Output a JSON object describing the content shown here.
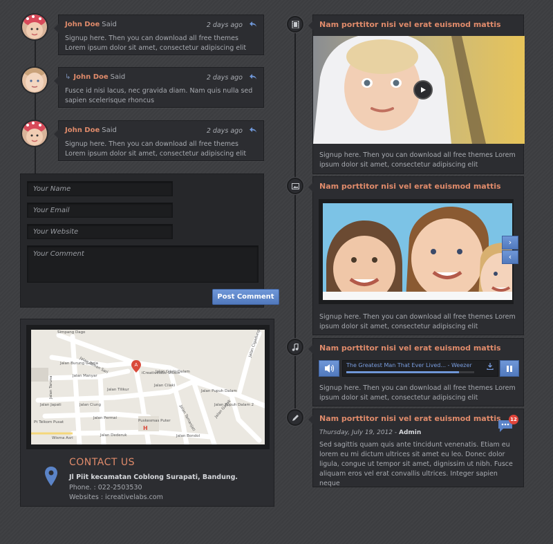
{
  "comments": [
    {
      "author": "John Doe",
      "said": "Said",
      "date": "2 days ago",
      "text": "Signup here. Then you can download all free themes Lorem ipsum dolor sit amet, consectetur adipiscing elit"
    },
    {
      "author": "John Doe",
      "said": "Said",
      "date": "2 days ago",
      "text": "Fusce id nisi lacus, nec gravida diam. Nam quis nulla sed sapien scelerisque rhoncus"
    },
    {
      "author": "John Doe",
      "said": "Said",
      "date": "2 days ago",
      "text": "Signup here. Then you can download all free themes Lorem ipsum dolor sit amet, consectetur adipiscing elit"
    }
  ],
  "form": {
    "name_placeholder": "Your Name",
    "email_placeholder": "Your Email",
    "website_placeholder": "Your Website",
    "comment_placeholder": "Your Comment",
    "submit_label": "Post Comment"
  },
  "map": {
    "labels": {
      "street1": "Jalan Taman Sari",
      "street2": "Jalan Burung Gereja",
      "street3": "Jalan Manyar",
      "street4": "Jalan Taruna",
      "street5": "Jalan Tilikur",
      "street6": "Jalan Japati",
      "street7": "Jalan Ciung",
      "street8": "Jalan Permai",
      "street9": "Jalan Dederuk",
      "street10": "Jalan Cilaki",
      "street11": "Jalan Cilaki Dalam",
      "street12": "Jalan Pupuh Dalam",
      "street13": "Jalan Pupuh Dalam 2",
      "street14": "Jalan Bondol",
      "street15": "Jalan Gagak",
      "street16": "Jalan Tamanjati",
      "street17": "Jalan Cigadung",
      "place1": "Simpang Dago",
      "place2": "iCreativelabs Studio",
      "place3": "Puskesmas Puter",
      "place4": "Pt Telkom Pusat",
      "place5": "Wisma Asri"
    }
  },
  "contact": {
    "title": "CONTACT US",
    "address": "Jl Piit kecamatan Coblong Surapati, Bandung.",
    "phone": "Phone. : 022-2503530",
    "website": "Websites : icreativelabs.com"
  },
  "posts": [
    {
      "title": "Nam porttitor nisi vel erat euismod mattis",
      "text": "Signup here. Then you can download all free themes Lorem ipsum dolor sit amet, consectetur adipiscing elit",
      "icon": "film-icon"
    },
    {
      "title": "Nam porttitor nisi vel erat euismod mattis",
      "text": "Signup here. Then you can download all free themes Lorem ipsum dolor sit amet, consectetur adipiscing elit",
      "icon": "image-icon"
    },
    {
      "title": "Nam porttitor nisi vel erat euismod mattis",
      "text": "Signup here. Then you can download all free themes Lorem ipsum dolor sit amet, consectetur adipiscing elit",
      "icon": "music-icon"
    },
    {
      "title": "Nam porttitor nisi vel erat euismod mattis",
      "date": "Thursday, July 19, 2012",
      "sep": " - ",
      "author": "Admin",
      "text": "Sed sagittis quam quis ante tincidunt venenatis. Etiam eu lorem eu mi dictum ultrices sit amet eu leo. Donec dolor ligula, congue ut tempor sit amet, dignissim ut nibh. Fusce aliquam eros vel erat convallis ultrices. Integer sapien neque",
      "icon": "pen-icon",
      "comment_count": "12"
    }
  ],
  "audio": {
    "track_title": "The Greatest Man That Ever Lived... - Weezer",
    "progress": 0.88
  },
  "colors": {
    "accent": "#e08b6b",
    "button": "#5b84c8",
    "background": "#3d3e41",
    "panel": "#2c2d31"
  }
}
